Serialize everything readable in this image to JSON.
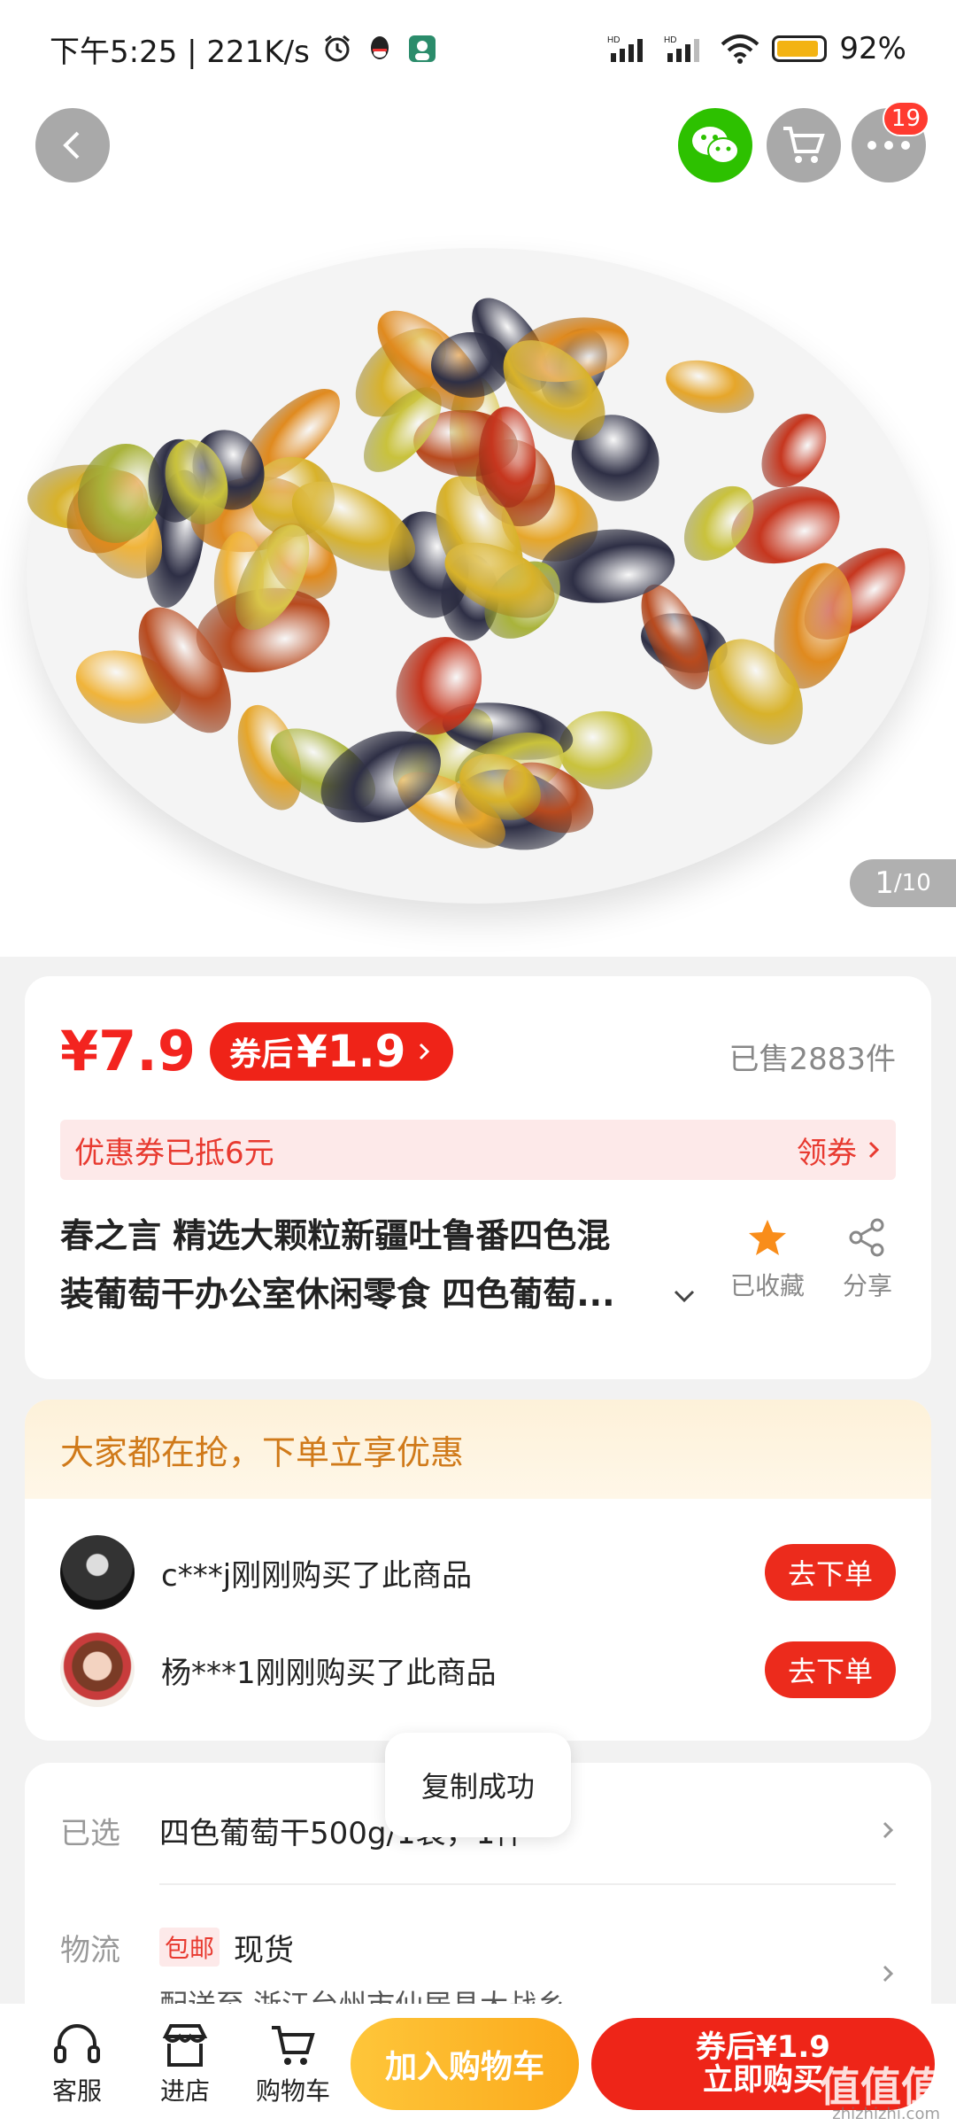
{
  "status_bar": {
    "time_speed": "下午5:25 | 221K/s",
    "battery": "92%",
    "battery_level": 0.92
  },
  "header": {
    "cart_badge": "19"
  },
  "gallery": {
    "indicator_current": "1",
    "indicator_total": "/10"
  },
  "price": {
    "current": "¥7.9",
    "coupon_prefix": "券后",
    "coupon_price": "¥1.9",
    "sold": "已售2883件"
  },
  "coupon_bar": {
    "text": "优惠券已抵6元",
    "action": "领券"
  },
  "product": {
    "title_line1": "春之言 精选大颗粒新疆吐鲁番四色混",
    "title_line2": "装葡萄干办公室休闲零食 四色葡萄...",
    "favorite_label": "已收藏",
    "share_label": "分享"
  },
  "buyers": {
    "header": "大家都在抢，下单立享优惠",
    "rows": [
      {
        "text": "c***j刚刚购买了此商品",
        "button": "去下单"
      },
      {
        "text": "杨***1刚刚购买了此商品",
        "button": "去下单"
      }
    ]
  },
  "spec": {
    "selected_label": "已选",
    "selected_value": "四色葡萄干500g/1袋，1件",
    "logistics_label": "物流",
    "mail_tag": "包邮",
    "stock": "现货",
    "ship_to": "配送至 浙江台州市仙居县大战乡"
  },
  "toast": "复制成功",
  "bottom_nav": {
    "service": "客服",
    "store": "进店",
    "cart": "购物车",
    "add_cart": "加入购物车",
    "buy_line1": "券后¥1.9",
    "buy_line2": "立即购买"
  },
  "watermark": "值值值",
  "watermark_sub": "zhizhizhi.com",
  "colors": {
    "accent_red": "#ee2518",
    "coupon_orange": "#fba91b",
    "wechat_green": "#2dc100"
  }
}
